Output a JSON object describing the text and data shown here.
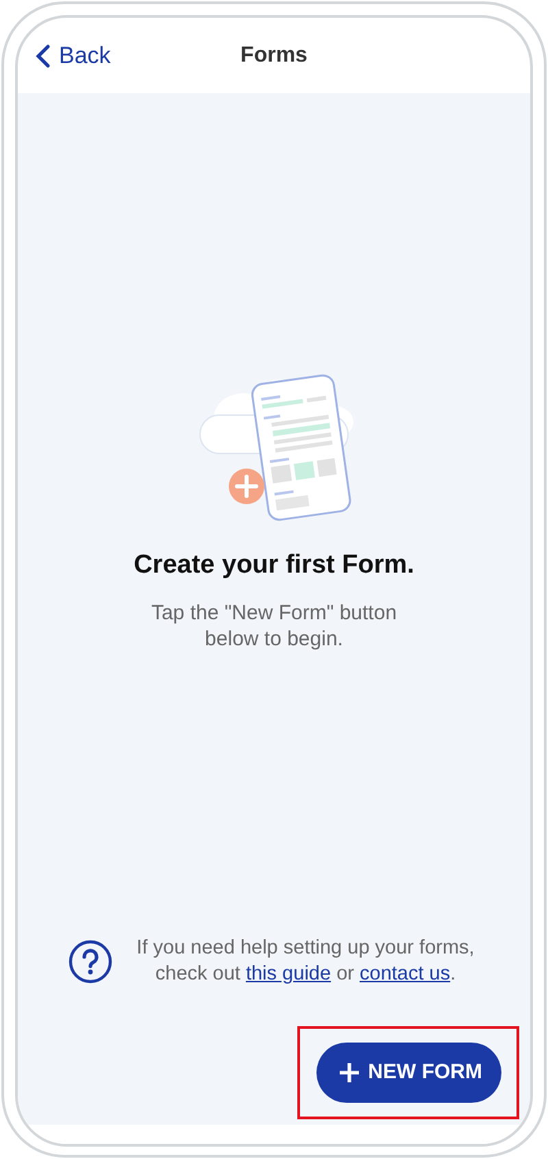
{
  "header": {
    "back_label": "Back",
    "title": "Forms"
  },
  "empty_state": {
    "title": "Create your first Form.",
    "message": "Tap the \"New Form\" button below to begin."
  },
  "help": {
    "before": "If you need help setting up your forms, check out ",
    "link_1": "this guide",
    "middle": " or ",
    "link_2": "contact us",
    "after": "."
  },
  "new_form_button": {
    "label": "NEW FORM",
    "highlighted": true
  }
}
